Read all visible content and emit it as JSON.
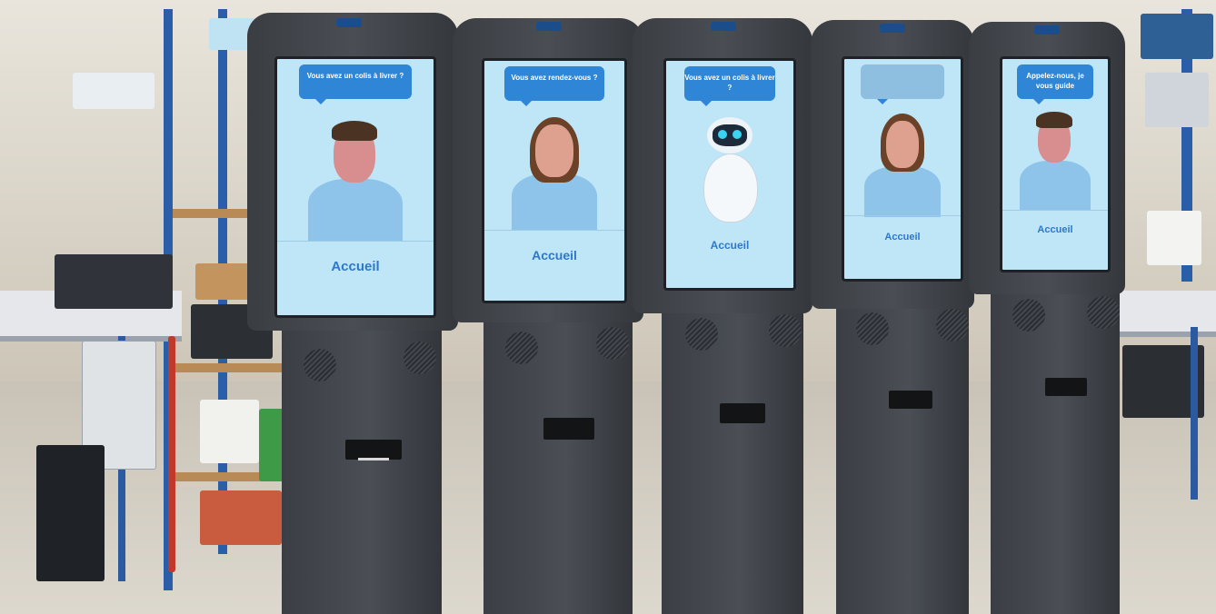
{
  "kiosks": [
    {
      "bubble_text": "Vous avez un colis à livrer ?",
      "label": "Accueil",
      "avatar": "man"
    },
    {
      "bubble_text": "Vous avez rendez-vous ?",
      "label": "Accueil",
      "avatar": "woman"
    },
    {
      "bubble_text": "Vous avez un colis à livrer ?",
      "label": "Accueil",
      "avatar": "robot"
    },
    {
      "bubble_text": "",
      "label": "Accueil",
      "avatar": "woman"
    },
    {
      "bubble_text": "Appelez-nous, je vous guide",
      "label": "Accueil",
      "avatar": "man"
    }
  ],
  "colors": {
    "kiosk_body": "#3f4348",
    "screen_bg": "#bfe6f7",
    "bubble": "#2f86d6",
    "accueil_text": "#2f77c9",
    "shelf_frame": "#2a5ea8"
  }
}
